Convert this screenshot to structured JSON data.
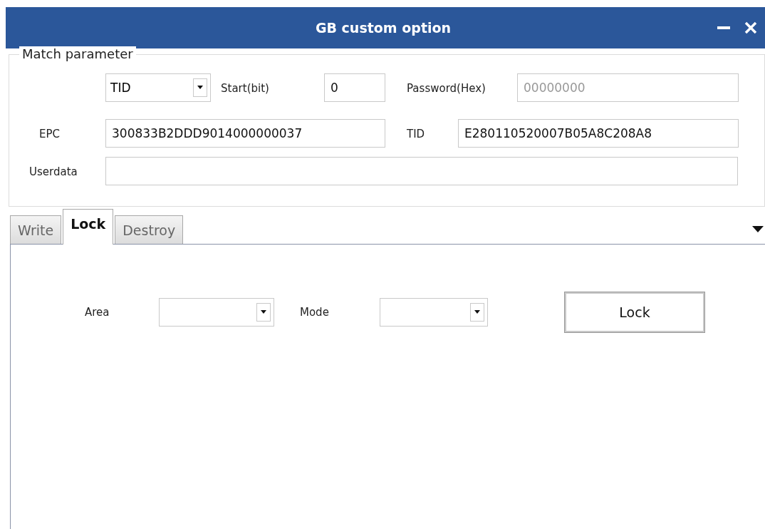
{
  "window": {
    "title": "GB custom option"
  },
  "match_parameter": {
    "legend": "Match parameter",
    "match_area": {
      "value": "TID"
    },
    "start": {
      "label": "Start(bit)",
      "value": "0"
    },
    "password": {
      "label": "Password(Hex)",
      "placeholder": "00000000"
    },
    "epc": {
      "label": "EPC",
      "value": "300833B2DDD9014000000037"
    },
    "tid": {
      "label": "TID",
      "value": "E280110520007B05A8C208A8"
    },
    "userdata": {
      "label": "Userdata"
    }
  },
  "tabs": [
    {
      "label": "Write",
      "selected": false
    },
    {
      "label": "Lock",
      "selected": true
    },
    {
      "label": "Destroy",
      "selected": false
    }
  ],
  "lock_panel": {
    "area": {
      "label": "Area"
    },
    "mode": {
      "label": "Mode"
    },
    "button": "Lock"
  }
}
